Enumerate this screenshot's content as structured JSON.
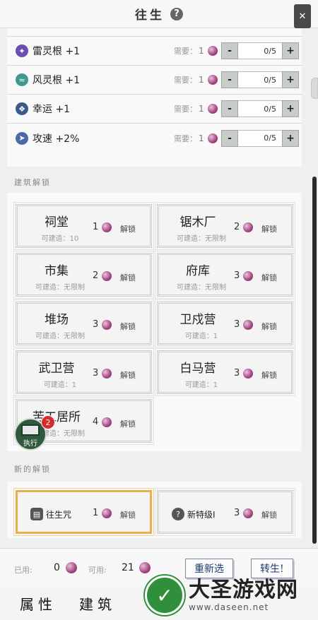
{
  "title": "往生",
  "close_symbol": "✕",
  "attributes": [
    {
      "name": "雷灵根 +1",
      "icon": "thunder-icon",
      "color": "#6a4fb0",
      "need_label": "需要：",
      "need": "1",
      "value": "0/5"
    },
    {
      "name": "风灵根 +1",
      "icon": "wind-icon",
      "color": "#3f9a8a",
      "need_label": "需要：",
      "need": "1",
      "value": "0/5"
    },
    {
      "name": "幸运 +1",
      "icon": "luck-icon",
      "color": "#3b5a8c",
      "need_label": "需要：",
      "need": "1",
      "value": "0/5"
    },
    {
      "name": "攻速 +2%",
      "icon": "speed-icon",
      "color": "#4c6aa8",
      "need_label": "需要：",
      "need": "1",
      "value": "0/5"
    }
  ],
  "stepper": {
    "minus": "-",
    "plus": "+"
  },
  "building_section_label": "建筑解锁",
  "buildings": [
    {
      "name": "祠堂",
      "sub": "可建造：10",
      "cost": "1",
      "unlock": "解锁"
    },
    {
      "name": "锯木厂",
      "sub": "可建造：无限制",
      "cost": "2",
      "unlock": "解锁"
    },
    {
      "name": "市集",
      "sub": "可建造：无限制",
      "cost": "2",
      "unlock": "解锁"
    },
    {
      "name": "府库",
      "sub": "可建造：无限制",
      "cost": "3",
      "unlock": "解锁"
    },
    {
      "name": "堆场",
      "sub": "可建造：无限制",
      "cost": "3",
      "unlock": "解锁"
    },
    {
      "name": "卫戍营",
      "sub": "可建造：1",
      "cost": "3",
      "unlock": "解锁"
    },
    {
      "name": "武卫营",
      "sub": "可建造：1",
      "cost": "3",
      "unlock": "解锁"
    },
    {
      "name": "白马营",
      "sub": "可建造：1",
      "cost": "3",
      "unlock": "解锁"
    },
    {
      "name": "苦工居所",
      "sub": "可建造：无限制",
      "cost": "4",
      "unlock": "解锁"
    }
  ],
  "new_section_label": "新的解锁",
  "new_unlocks": [
    {
      "name": "往生咒",
      "icon": "book-icon",
      "cost": "1",
      "unlock": "解锁"
    },
    {
      "name": "新特级I",
      "icon": "question-icon",
      "cost": "3",
      "unlock": "解锁"
    }
  ],
  "bottom": {
    "used_label": "已用:",
    "used": "0",
    "avail_label": "可用:",
    "avail": "21",
    "reset": "重新选",
    "rebirth": "转生!"
  },
  "tabs": [
    "属性",
    "建筑"
  ],
  "fab": {
    "label": "执行",
    "badge": "2"
  },
  "watermark": {
    "title": "大圣游戏网",
    "url": "www.daseen.net"
  }
}
